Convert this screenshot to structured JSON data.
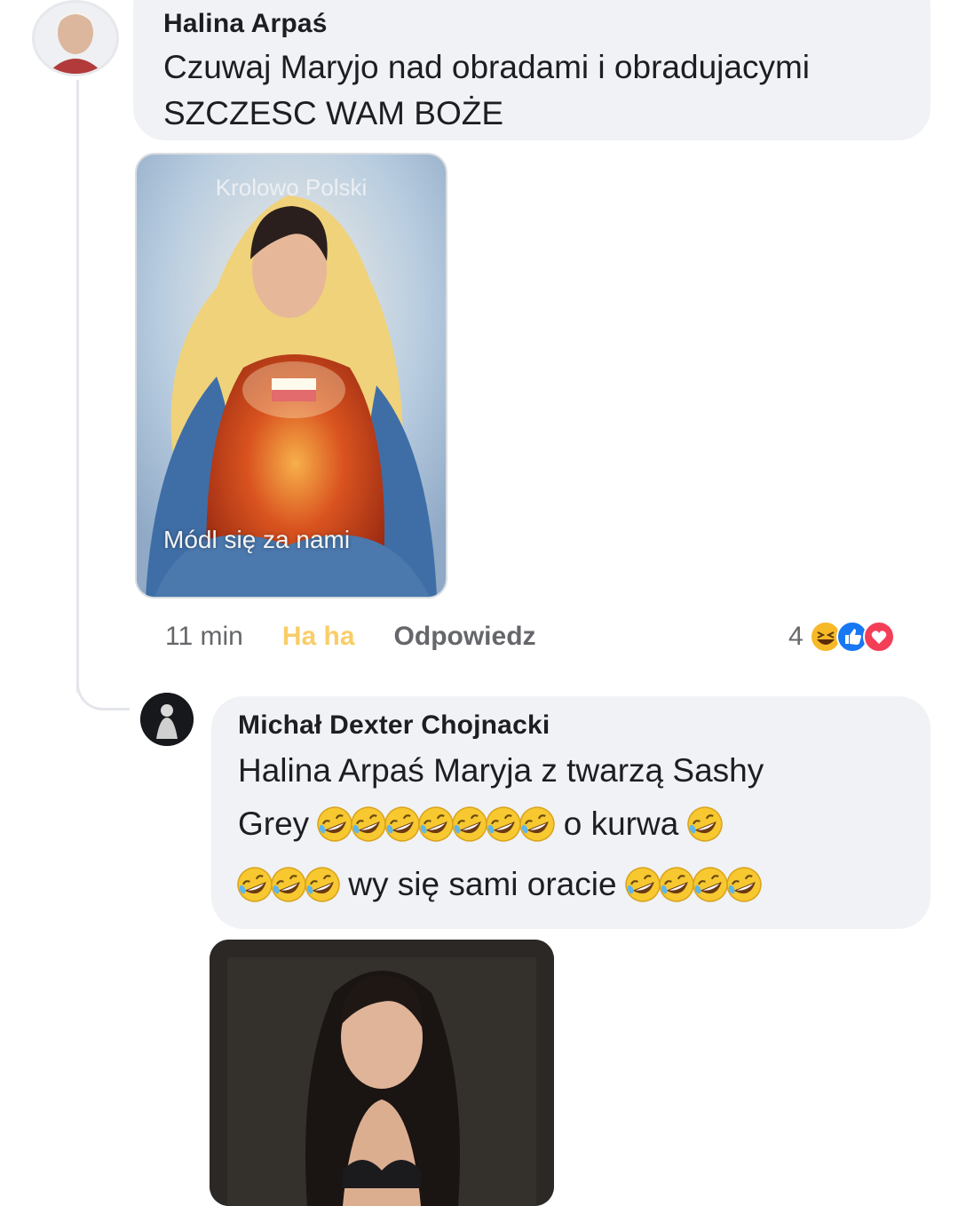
{
  "comment": {
    "author": "Halina Arpaś",
    "text_line1": "Czuwaj Maryjo nad obradami i obradujacymi",
    "text_line2": "SZCZESC WAM BOŻE",
    "attachment": {
      "caption_top": "Krolowo Polski",
      "caption_bottom": "Módl się za nami"
    },
    "meta": {
      "time": "11 min",
      "reaction_label": "Ha ha",
      "reply_label": "Odpowiedz"
    },
    "reactions": {
      "count": "4",
      "icons": [
        "haha-icon",
        "like-icon",
        "love-icon"
      ]
    }
  },
  "reply": {
    "author": "Michał Dexter Chojnacki",
    "text_part1": "Halina Arpaś Maryja z twarzą Sashy",
    "text_part2": "Grey",
    "text_part3": "o kurwa",
    "text_part4": "wy się sami oracie",
    "emoji_name": "rofl-emoji"
  },
  "colors": {
    "bubble": "#f0f2f5",
    "meta_text": "#65676b",
    "like_blue": "#1877f2",
    "love_red": "#f33e58",
    "haha_yellow": "#f7b928"
  }
}
